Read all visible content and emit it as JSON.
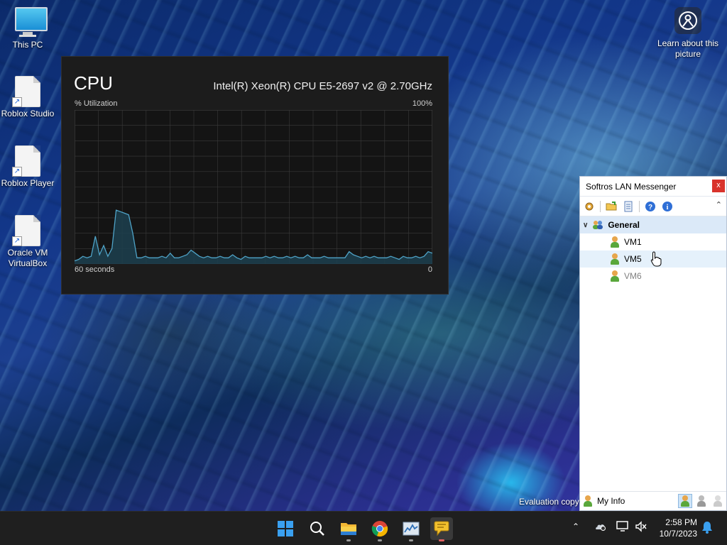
{
  "desktop": {
    "icons": [
      {
        "label": "This PC"
      },
      {
        "label": "Roblox Studio"
      },
      {
        "label": "Roblox Player"
      },
      {
        "label": "Oracle VM VirtualBox"
      }
    ],
    "learn_about_picture": "Learn about this picture",
    "evaluation_text": "Evaluation copy"
  },
  "cpu_widget": {
    "title": "CPU",
    "model": "Intel(R) Xeon(R) CPU E5-2697 v2 @ 2.70GHz",
    "y_label": "% Utilization",
    "y_max_label": "100%",
    "x_left_label": "60 seconds",
    "x_right_label": "0",
    "colors": {
      "line": "#4fa3c7",
      "fill": "#1c3f4f",
      "grid": "#3a3a3a"
    },
    "utilization": [
      2,
      3,
      5,
      4,
      5,
      18,
      6,
      12,
      5,
      10,
      35,
      34,
      33,
      32,
      20,
      4,
      4,
      5,
      4,
      4,
      4,
      5,
      4,
      7,
      4,
      4,
      5,
      6,
      9,
      7,
      5,
      4,
      5,
      4,
      4,
      5,
      4,
      4,
      6,
      4,
      3,
      5,
      4,
      4,
      4,
      4,
      5,
      4,
      5,
      4,
      4,
      5,
      4,
      5,
      4,
      4,
      6,
      4,
      4,
      4,
      5,
      4,
      4,
      4,
      4,
      4,
      8,
      6,
      5,
      4,
      5,
      4,
      5,
      4,
      4,
      4,
      5,
      4,
      3,
      5,
      4,
      4,
      5,
      4,
      5,
      8,
      7
    ]
  },
  "messenger": {
    "title": "Softros LAN Messenger",
    "close_label": "x",
    "toolbar": [
      "settings-icon",
      "folder-icon",
      "history-icon",
      "help-icon",
      "info-icon"
    ],
    "group": "General",
    "users": [
      {
        "name": "VM1",
        "status": "online"
      },
      {
        "name": "VM5",
        "status": "online"
      },
      {
        "name": "VM6",
        "status": "away"
      }
    ],
    "footer_label": "My Info"
  },
  "taskbar": {
    "apps": [
      "start-icon",
      "search-icon",
      "file-explorer-icon",
      "chrome-icon",
      "task-manager-icon",
      "softros-messenger-icon"
    ],
    "clock": {
      "time": "2:58 PM",
      "date": "10/7/2023"
    }
  }
}
